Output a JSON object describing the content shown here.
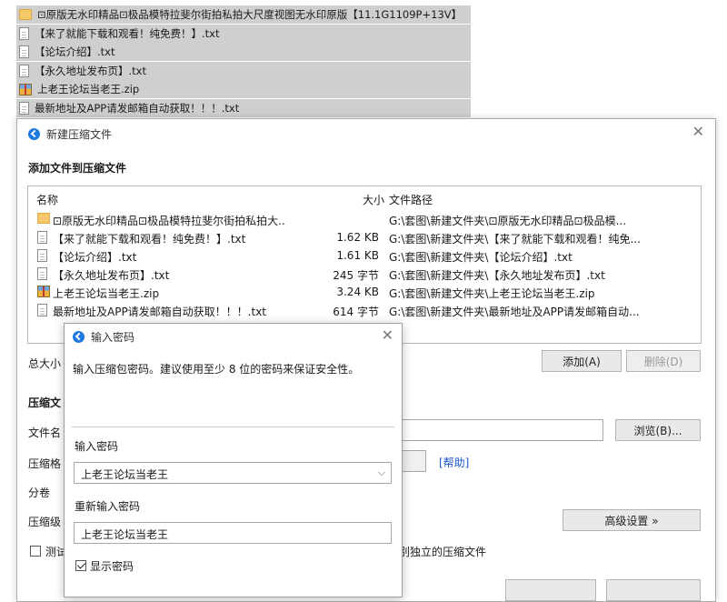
{
  "background_list": [
    {
      "icon": "folder",
      "text": "⊡原版无水印精品⊡极品模特拉斐尔街拍私拍大尺度视图无水印原版【11.1G1109P+13V】"
    },
    {
      "icon": "file",
      "text": "【来了就能下载和观看！纯免费！】.txt"
    },
    {
      "icon": "file",
      "text": "【论坛介绍】.txt"
    },
    {
      "icon": "file",
      "text": "【永久地址发布页】.txt"
    },
    {
      "icon": "zip",
      "text": "上老王论坛当老王.zip"
    },
    {
      "icon": "file",
      "text": "最新地址及APP请发邮箱自动获取！！！.txt"
    }
  ],
  "main_dialog": {
    "title": "新建压缩文件",
    "add_section": "添加文件到压缩文件",
    "columns": {
      "name": "名称",
      "size": "大小",
      "path": "文件路径"
    },
    "files": [
      {
        "icon": "folder",
        "name": "⊡原版无水印精品⊡极品模特拉斐尔街拍私拍大...",
        "size": "",
        "path": "G:\\套图\\新建文件夹\\⊡原版无水印精品⊡极品模..."
      },
      {
        "icon": "file",
        "name": "【来了就能下载和观看！纯免费！】.txt",
        "size": "1.62 KB",
        "path": "G:\\套图\\新建文件夹\\【来了就能下载和观看！纯免..."
      },
      {
        "icon": "file",
        "name": "【论坛介绍】.txt",
        "size": "1.61 KB",
        "path": "G:\\套图\\新建文件夹\\【论坛介绍】.txt"
      },
      {
        "icon": "file",
        "name": "【永久地址发布页】.txt",
        "size": "245 字节",
        "path": "G:\\套图\\新建文件夹\\【永久地址发布页】.txt"
      },
      {
        "icon": "zip",
        "name": "上老王论坛当老王.zip",
        "size": "3.24 KB",
        "path": "G:\\套图\\新建文件夹\\上老王论坛当老王.zip"
      },
      {
        "icon": "file",
        "name": "最新地址及APP请发邮箱自动获取！！！.txt",
        "size": "614 字节",
        "path": "G:\\套图\\新建文件夹\\最新地址及APP请发邮箱自动..."
      }
    ],
    "total_size_label": "总大小",
    "add_button": "添加(A)",
    "delete_button": "删除(D)",
    "compress_section": "压缩文",
    "filename_label": "文件名",
    "browse_button": "浏览(B)...",
    "format_label": "压缩格",
    "help_link": "[帮助]",
    "split_label": "分卷",
    "level_label": "压缩级",
    "advanced_button": "高级设置 »",
    "test_label": "测试",
    "separate_label": "别独立的压缩文件"
  },
  "password_dialog": {
    "title": "输入密码",
    "hint": "输入压缩包密码。建议使用至少 8 位的密码来保证安全性。",
    "enter_label": "输入密码",
    "enter_value": "上老王论坛当老王",
    "reenter_label": "重新输入密码",
    "reenter_value": "上老王论坛当老王",
    "show_password_label": "显示密码",
    "show_password_checked": true
  }
}
